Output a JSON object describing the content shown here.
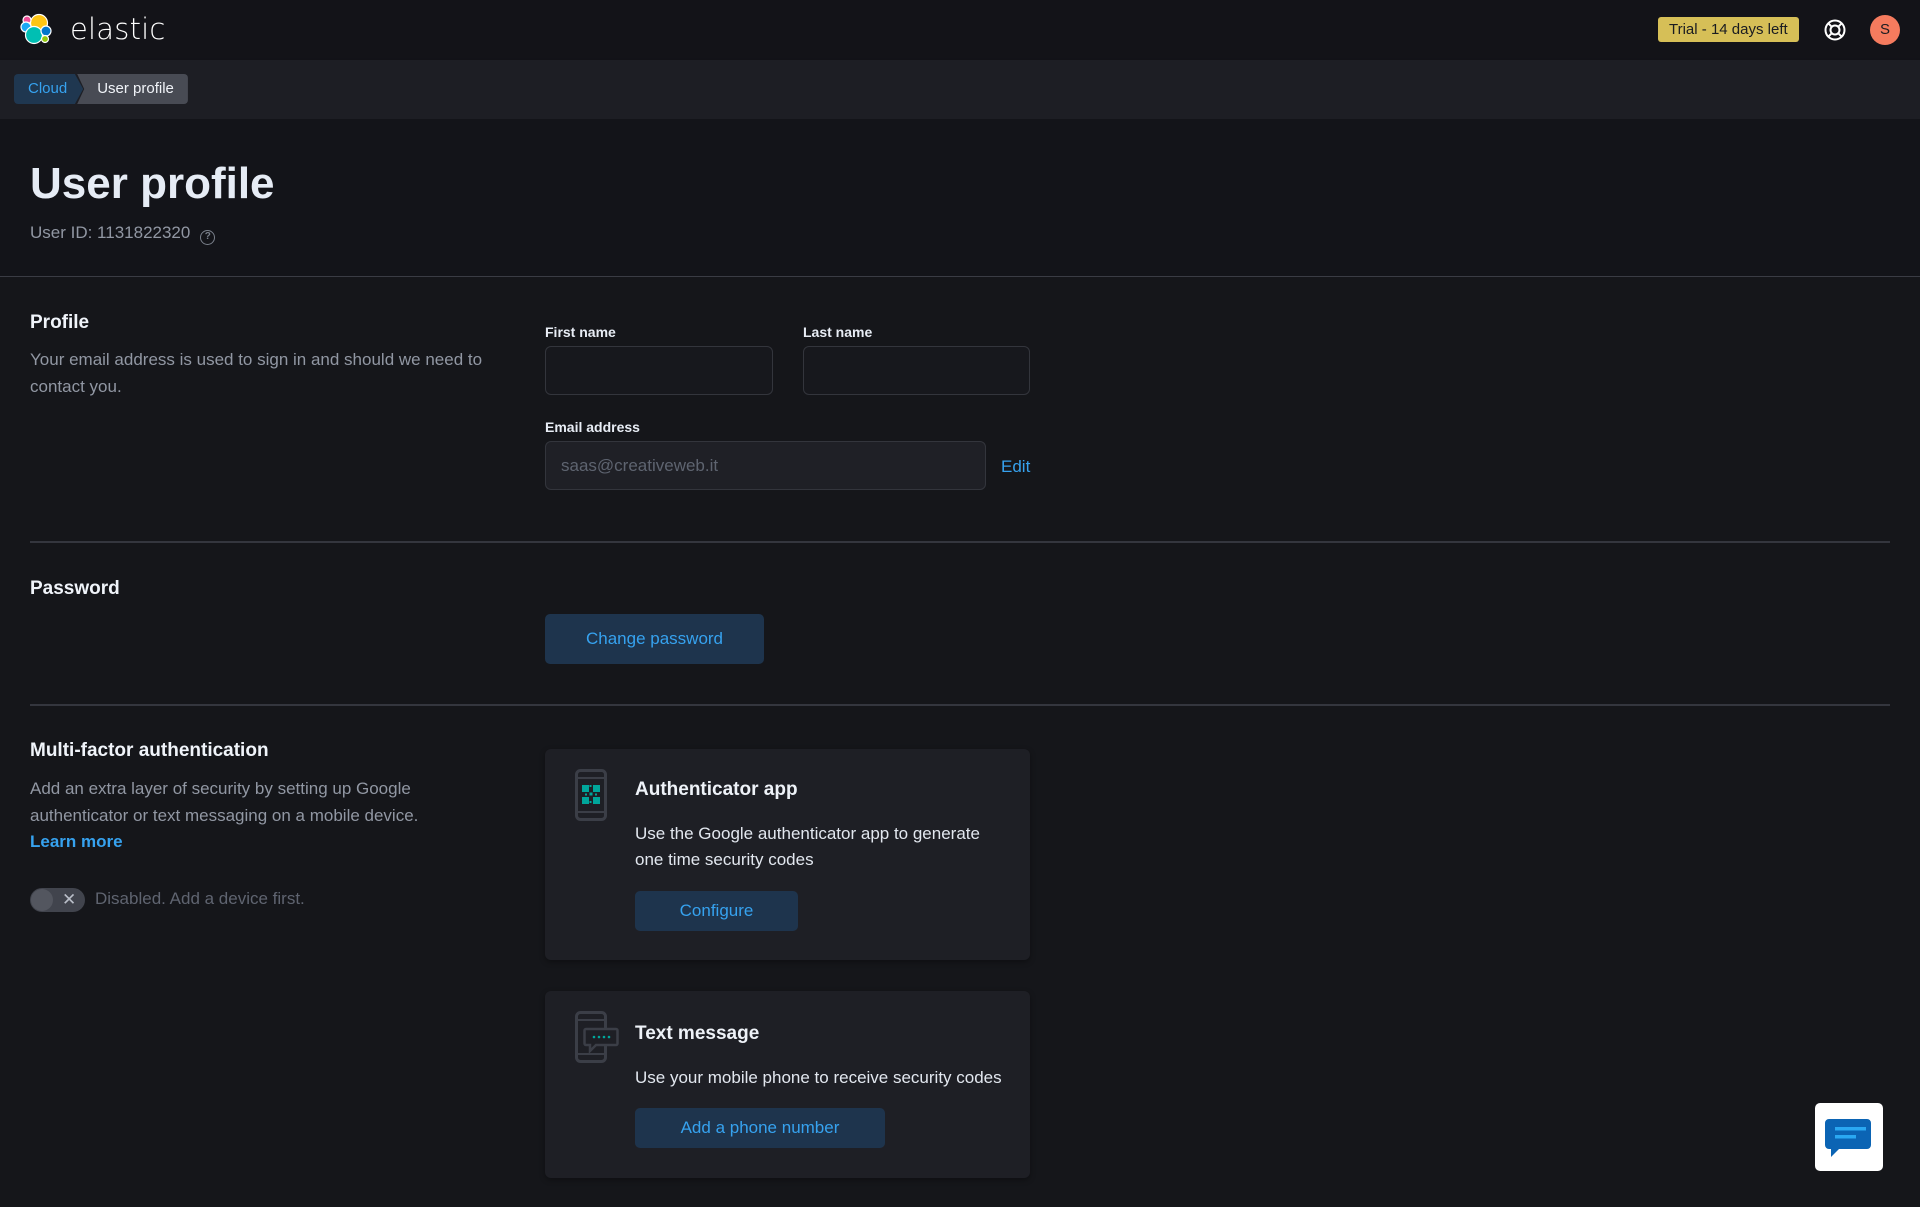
{
  "header": {
    "brand": "elastic",
    "trial_badge": "Trial - 14 days left",
    "help_icon": "life-buoy-icon",
    "avatar_initial": "S",
    "colors": {
      "trial": "#d6bf57",
      "avatar": "#f57b5e"
    }
  },
  "breadcrumb": [
    {
      "label": "Cloud"
    },
    {
      "label": "User profile"
    }
  ],
  "page": {
    "title": "User profile",
    "user_id_label": "User ID: 1131822320",
    "help_glyph": "?"
  },
  "profile": {
    "title": "Profile",
    "description": "Your email address is used to sign in and should we need to contact you.",
    "first_name_label": "First name",
    "first_name_value": "",
    "last_name_label": "Last name",
    "last_name_value": "",
    "email_label": "Email address",
    "email_placeholder": "saas@creativeweb.it",
    "edit_label": "Edit"
  },
  "password": {
    "title": "Password",
    "change_label": "Change password"
  },
  "mfa": {
    "title": "Multi-factor authentication",
    "description": "Add an extra layer of security by setting up Google authenticator or text messaging on a mobile device.",
    "learn_more": "Learn more",
    "toggle_state": "off",
    "toggle_glyph": "✕",
    "toggle_label": "Disabled. Add a device first.",
    "methods": [
      {
        "icon": "authenticator-phone-icon",
        "title": "Authenticator app",
        "description": "Use the Google authenticator app to generate one time security codes",
        "button": "Configure"
      },
      {
        "icon": "sms-phone-icon",
        "title": "Text message",
        "description": "Use your mobile phone to receive security codes",
        "button": "Add a phone number"
      }
    ]
  },
  "chat": {
    "icon": "chat-bubble-icon"
  }
}
